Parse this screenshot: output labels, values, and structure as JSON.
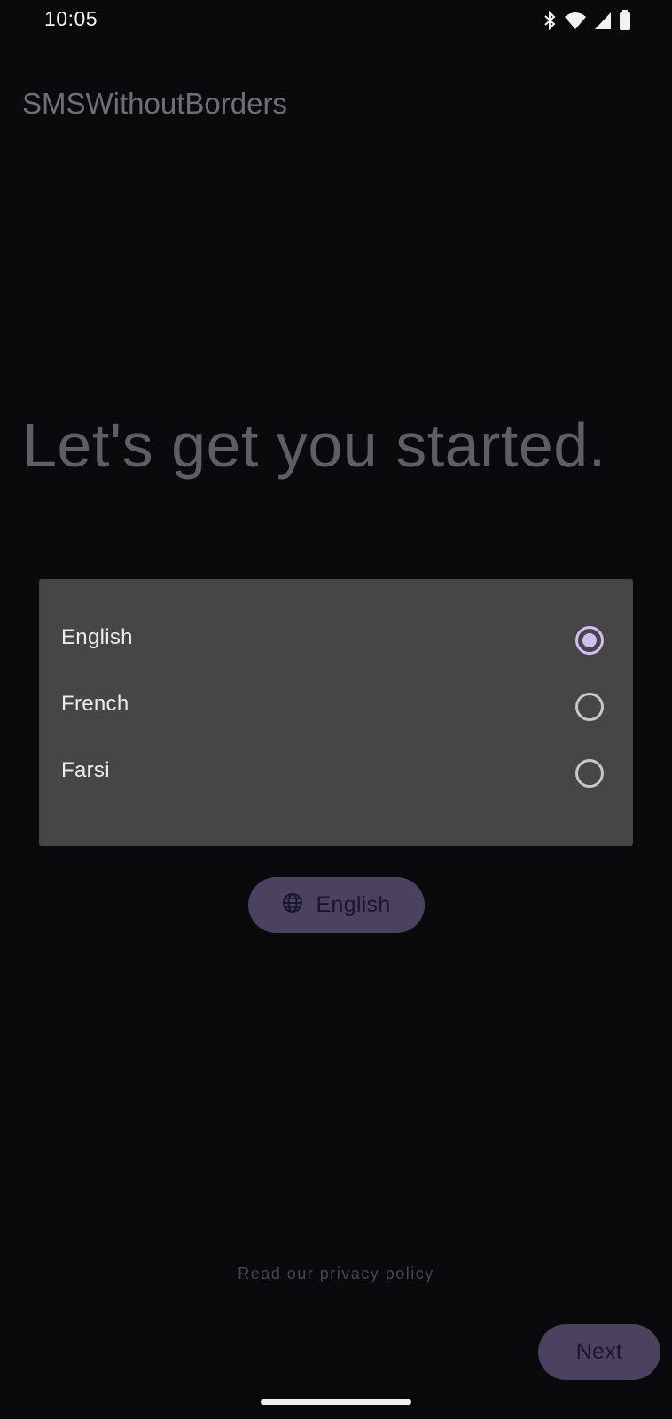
{
  "status_bar": {
    "time": "10:05",
    "icons": [
      "bluetooth-icon",
      "wifi-icon",
      "signal-icon",
      "battery-icon"
    ]
  },
  "app": {
    "title": "SMSWithoutBorders"
  },
  "onboarding": {
    "heading": "Let's get you started."
  },
  "language_dialog": {
    "options": [
      {
        "label": "English",
        "selected": true
      },
      {
        "label": "French",
        "selected": false
      },
      {
        "label": "Farsi",
        "selected": false
      }
    ]
  },
  "language_button": {
    "icon": "globe-icon",
    "label": "English"
  },
  "footer": {
    "privacy_link": "Read our privacy policy",
    "next_label": "Next"
  },
  "colors": {
    "background": "#0a0a0c",
    "dialog": "#464646",
    "accent": "#cfbdf5",
    "button": "#4a425e"
  }
}
